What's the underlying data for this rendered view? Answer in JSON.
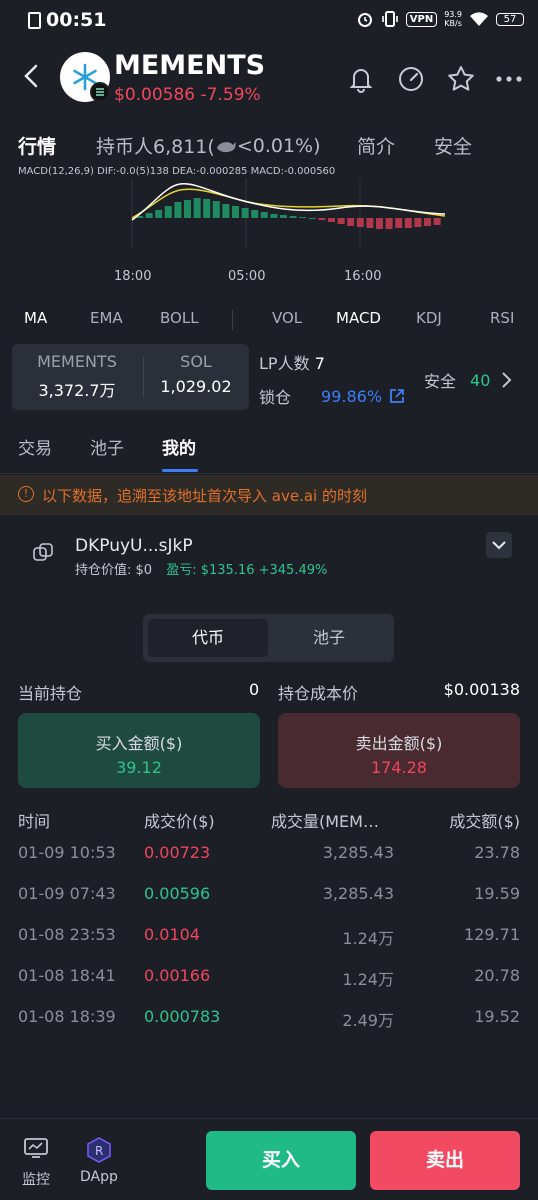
{
  "status_bar": {
    "time": "00:51",
    "vpn": "VPN",
    "speed_value": "93.9",
    "speed_unit": "KB/s",
    "battery": "57"
  },
  "header": {
    "token_name": "MEMENTS",
    "price": "$0.00586",
    "change": "-7.59%"
  },
  "main_tabs": [
    "行情",
    "持币人6,811(",
    "<0.01%)",
    "简介",
    "安全"
  ],
  "chart": {
    "macd_legend": "MACD(12,26,9)  DIF:-0.0(5)138  DEA:-0.000285  MACD:-0.000560",
    "time_labels": [
      "18:00",
      "05:00",
      "16:00"
    ]
  },
  "indicators": [
    "MA",
    "EMA",
    "BOLL",
    "VOL",
    "MACD",
    "KDJ",
    "RSI"
  ],
  "pool": {
    "token_label": "MEMENTS",
    "token_value": "3,372.7万",
    "quote_label": "SOL",
    "quote_value": "1,029.02",
    "lp_label": "LP人数",
    "lp_value": "7",
    "lock_label": "锁仓",
    "lock_value": "99.86%",
    "safe_label": "安全",
    "safe_value": "40"
  },
  "sub_tabs": [
    "交易",
    "池子",
    "我的"
  ],
  "notice": "以下数据，追溯至该地址首次导入 ave.ai 的时刻",
  "wallet": {
    "address": "DKPuyU...sJkP",
    "holding_label": "持仓价值: $0",
    "pnl_label": "盈亏:",
    "pnl_value": "$135.16 +345.49%"
  },
  "toggle": [
    "代币",
    "池子"
  ],
  "holding": {
    "current_label": "当前持仓",
    "current_value": "0",
    "cost_label": "持仓成本价",
    "cost_value": "$0.00138"
  },
  "amounts": {
    "buy_label": "买入金额($)",
    "buy_value": "39.12",
    "sell_label": "卖出金额($)",
    "sell_value": "174.28"
  },
  "table": {
    "headers": [
      "时间",
      "成交价($)",
      "成交量(MEM…",
      "成交额($)"
    ],
    "rows": [
      {
        "time": "01-09 10:53",
        "price": "0.00723",
        "side": "sell",
        "qty": "3,285.43",
        "amount": "23.78"
      },
      {
        "time": "01-09 07:43",
        "price": "0.00596",
        "side": "buy",
        "qty": "3,285.43",
        "amount": "19.59"
      },
      {
        "time": "01-08 23:53",
        "price": "0.0104",
        "side": "sell",
        "qty": "1.24万",
        "amount": "129.71"
      },
      {
        "time": "01-08 18:41",
        "price": "0.00166",
        "side": "sell",
        "qty": "1.24万",
        "amount": "20.78"
      },
      {
        "time": "01-08 18:39",
        "price": "0.000783",
        "side": "buy",
        "qty": "2.49万",
        "amount": "19.52"
      }
    ]
  },
  "bottom_nav": {
    "monitor": "监控",
    "dapp": "DApp",
    "buy": "买入",
    "sell": "卖出"
  },
  "colors": {
    "green": "#2ec48d",
    "red": "#f0465e",
    "accent": "#3d7ef5",
    "warning": "#e0702a"
  }
}
